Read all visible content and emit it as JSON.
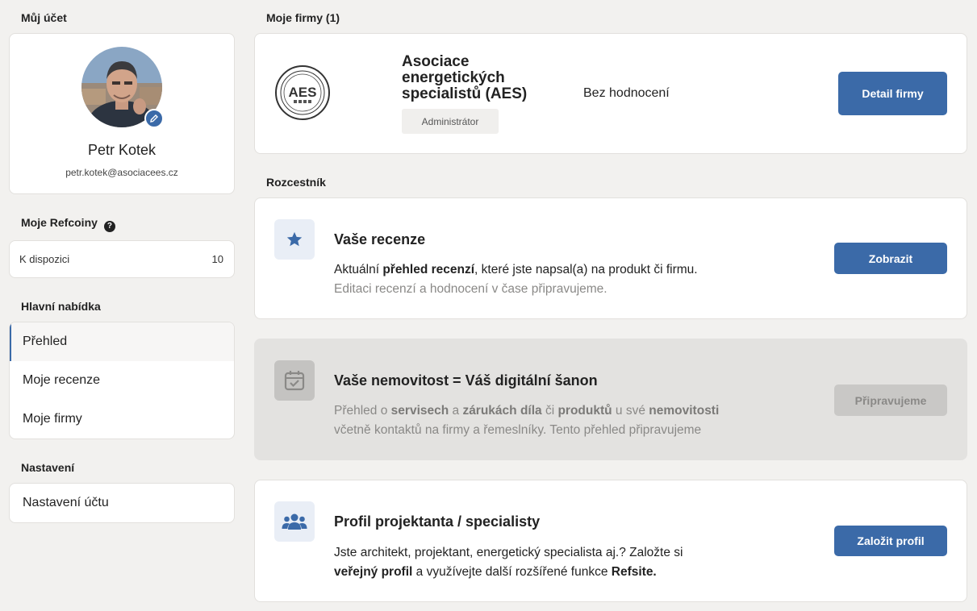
{
  "sidebar": {
    "account_heading": "Můj účet",
    "user": {
      "name": "Petr Kotek",
      "email": "petr.kotek@asociacees.cz"
    },
    "refcoins": {
      "heading": "Moje Refcoiny",
      "help": "?",
      "label": "K dispozici",
      "value": "10"
    },
    "menu_heading": "Hlavní nabídka",
    "menu": [
      {
        "label": "Přehled"
      },
      {
        "label": "Moje recenze"
      },
      {
        "label": "Moje firmy"
      }
    ],
    "settings_heading": "Nastavení",
    "settings_item": "Nastavení účtu"
  },
  "firms": {
    "heading": "Moje firmy (1)",
    "firm": {
      "logo_text": "AES",
      "name": "Asociace energetických specialistů (AES)",
      "role": "Administrátor",
      "rating": "Bez hodnocení",
      "button": "Detail firmy"
    }
  },
  "crossroads": {
    "heading": "Rozcestník",
    "reviews": {
      "title": "Vaše recenze",
      "text_a": "Aktuální ",
      "text_b": "přehled recenzí",
      "text_c": ", které jste napsal(a) na produkt či firmu.",
      "muted": "Editaci recenzí a hodnocení v čase připravujeme.",
      "button": "Zobrazit"
    },
    "estate": {
      "title": "Vaše nemovitost = Váš digitální šanon",
      "t1": "Přehled o ",
      "t2": "servisech",
      "t3": " a ",
      "t4": "zárukách díla",
      "t5": " či ",
      "t6": "produktů",
      "t7": " u své ",
      "t8": "nemovitosti",
      "line2": "včetně kontaktů na firmy a řemeslníky. Tento přehled připravujeme",
      "button": "Připravujeme"
    },
    "profile": {
      "title": "Profil projektanta / specialisty",
      "line1": "Jste architekt, projektant, energetický specialista aj.? Založte si",
      "b1": "veřejný profil",
      "t2": " a využívejte další rozšířené funkce ",
      "b2": "Refsite.",
      "button": "Založit profil"
    }
  },
  "colors": {
    "accent": "#3b6aa8",
    "background": "#f2f1ef",
    "disabled": "#c9c8c6"
  }
}
